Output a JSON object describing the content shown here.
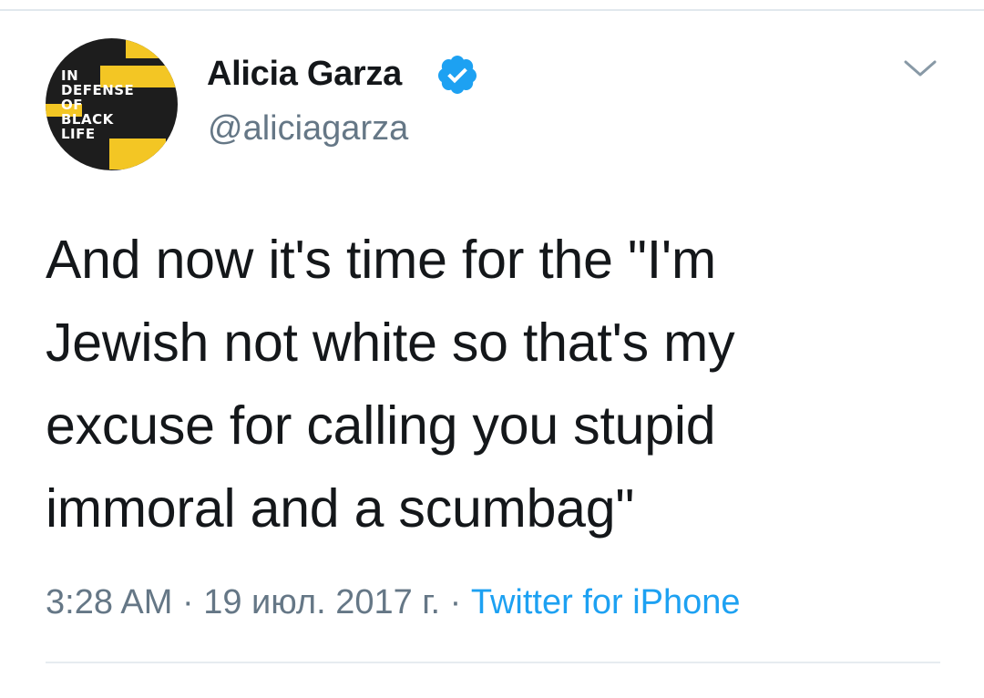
{
  "author": {
    "display_name": "Alicia Garza",
    "handle": "@aliciagarza",
    "verified": true,
    "avatar_text": [
      "IN",
      "DEFENSE",
      "OF",
      "BLACK",
      "LIFE"
    ],
    "avatar_icon": "in-defense-of-black-life-logo"
  },
  "tweet": {
    "lines": [
      "And now it's time for the \"I'm",
      "Jewish not white so that's my",
      "excuse for calling you stupid",
      "immoral and a scumbag\""
    ]
  },
  "meta": {
    "time": "3:28 AM",
    "separator1": " · ",
    "date": "19 июл. 2017 г.",
    "separator2": " · ",
    "source": "Twitter for iPhone"
  },
  "colors": {
    "text": "#14171a",
    "secondary": "#657786",
    "link": "#1da1f2",
    "verified": "#1da1f2",
    "avatar_bg": "#1d1d1d",
    "avatar_accent": "#f3c624"
  },
  "icons": {
    "verified": "verified-badge-icon",
    "more": "chevron-down-icon"
  }
}
